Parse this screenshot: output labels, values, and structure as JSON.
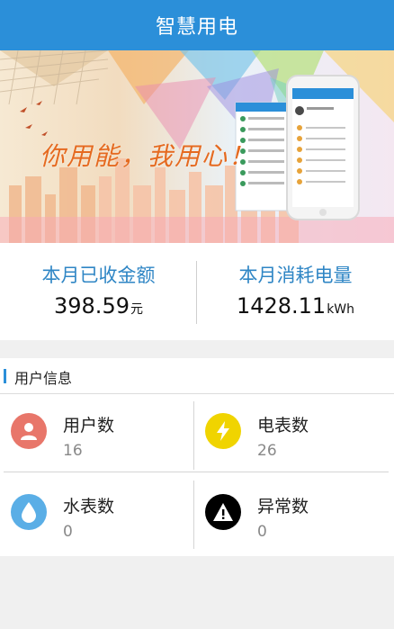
{
  "header": {
    "title": "智慧用电"
  },
  "banner": {
    "slogan": "你用能，我用心！"
  },
  "stats": {
    "collected": {
      "label": "本月已收金额",
      "value": "398.59",
      "unit": "元"
    },
    "consumed": {
      "label": "本月消耗电量",
      "value": "1428.11",
      "unit": "kWh"
    }
  },
  "user_info": {
    "title": "用户信息",
    "items": [
      {
        "name": "用户数",
        "count": "16",
        "icon": "user-icon",
        "color": "#e8766a"
      },
      {
        "name": "电表数",
        "count": "26",
        "icon": "lightning-icon",
        "color": "#f0d400"
      },
      {
        "name": "水表数",
        "count": "0",
        "icon": "water-drop-icon",
        "color": "#5aaee6"
      },
      {
        "name": "异常数",
        "count": "0",
        "icon": "warning-icon",
        "color": "#000000"
      }
    ]
  }
}
